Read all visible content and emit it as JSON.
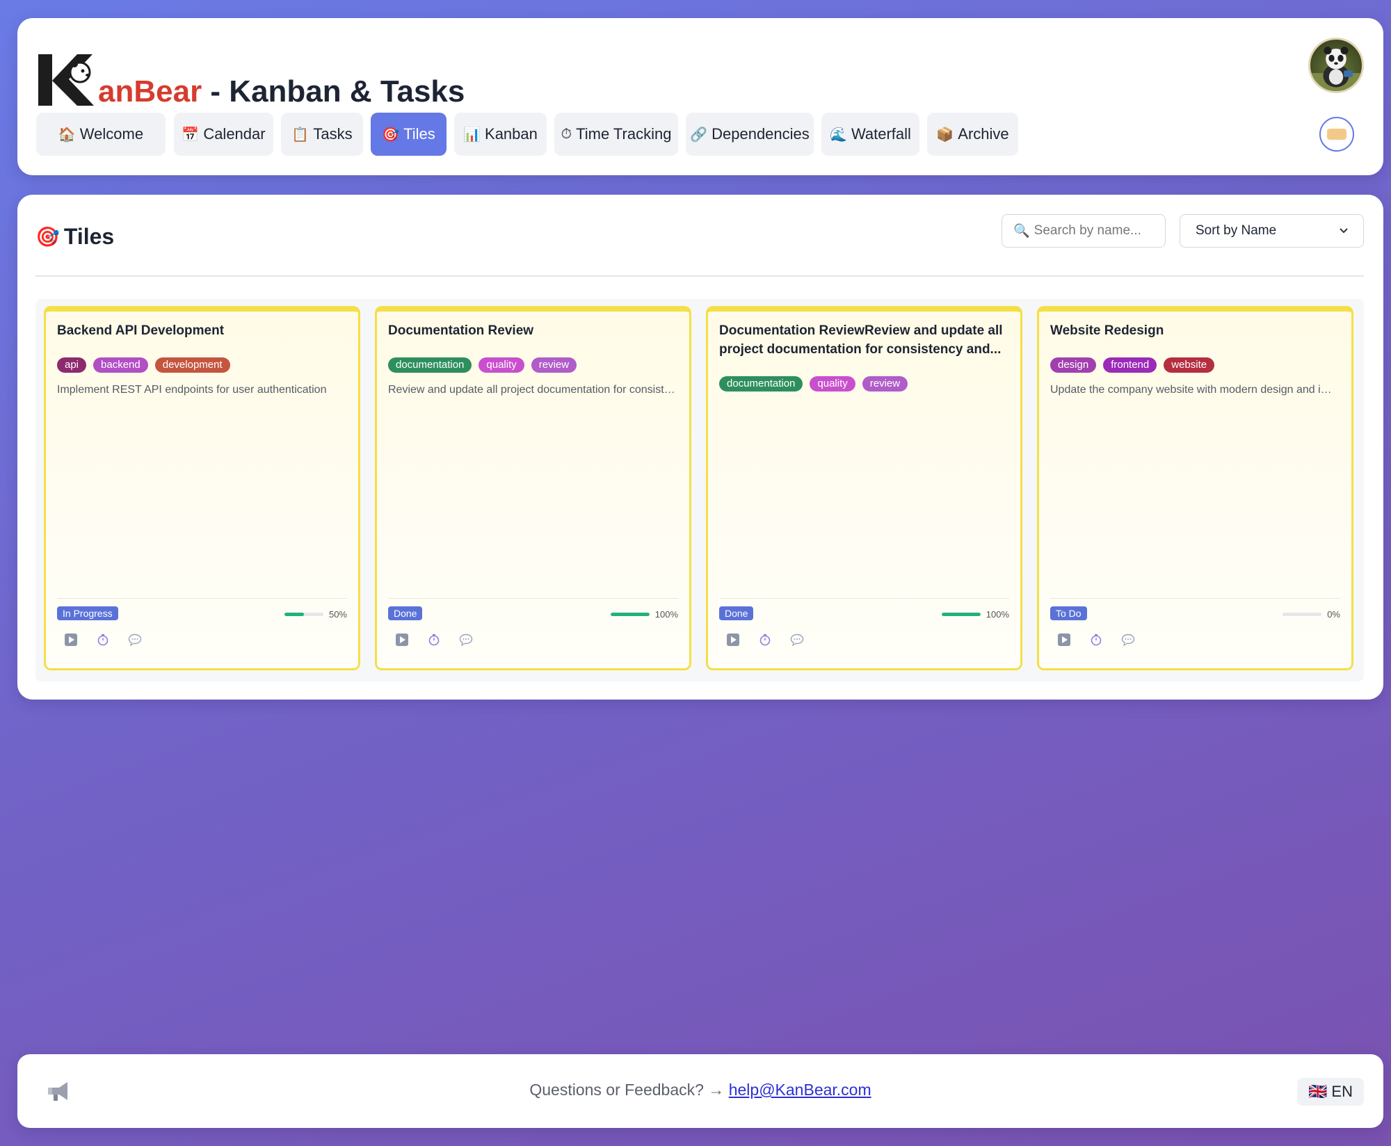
{
  "header": {
    "brand_suffix": "anBear",
    "title_rest": " - Kanban & Tasks",
    "nav": [
      {
        "icon": "🏠",
        "label": "Welcome",
        "active": false
      },
      {
        "icon": "📅",
        "label": "Calendar",
        "active": false
      },
      {
        "icon": "📋",
        "label": "Tasks",
        "active": false
      },
      {
        "icon": "🎯",
        "label": "Tiles",
        "active": true
      },
      {
        "icon": "📊",
        "label": "Kanban",
        "active": false
      },
      {
        "icon": "⏱",
        "label": "Time Tracking",
        "active": false
      },
      {
        "icon": "🔗",
        "label": "Dependencies",
        "active": false
      },
      {
        "icon": "🌊",
        "label": "Waterfall",
        "active": false
      },
      {
        "icon": "📦",
        "label": "Archive",
        "active": false
      }
    ]
  },
  "main": {
    "title_icon": "🎯",
    "title": "Tiles",
    "search_placeholder": "Search by name...",
    "sort_label": "Sort by Name",
    "tiles": [
      {
        "title": "Backend API Development",
        "tags": [
          {
            "label": "api",
            "color": "#8e2a6e"
          },
          {
            "label": "backend",
            "color": "#b14fc4"
          },
          {
            "label": "development",
            "color": "#c4553f"
          }
        ],
        "description": "Implement REST API endpoints for user authentication",
        "status": "In Progress",
        "progress": 50,
        "progress_label": "50%"
      },
      {
        "title": "Documentation Review",
        "tags": [
          {
            "label": "documentation",
            "color": "#2e8f5e"
          },
          {
            "label": "quality",
            "color": "#c94fcf"
          },
          {
            "label": "review",
            "color": "#b05cc9"
          }
        ],
        "description": "Review and update all project documentation for consistency",
        "status": "Done",
        "progress": 100,
        "progress_label": "100%"
      },
      {
        "title": "Documentation ReviewReview and update all project documentation for consistency and...",
        "tags": [
          {
            "label": "documentation",
            "color": "#2e8f5e"
          },
          {
            "label": "quality",
            "color": "#c94fcf"
          },
          {
            "label": "review",
            "color": "#b05cc9"
          }
        ],
        "description": "",
        "status": "Done",
        "progress": 100,
        "progress_label": "100%"
      },
      {
        "title": "Website Redesign",
        "tags": [
          {
            "label": "design",
            "color": "#a23fae"
          },
          {
            "label": "frontend",
            "color": "#9b2ab8"
          },
          {
            "label": "website",
            "color": "#b52e3f"
          }
        ],
        "description": "Update the company website with modern design and improved UX",
        "status": "To Do",
        "progress": 0,
        "progress_label": "0%"
      }
    ]
  },
  "footer": {
    "feedback_text": "Questions or Feedback? → ",
    "email": "help@KanBear.com",
    "lang_flag": "🇬🇧",
    "lang": "EN"
  },
  "icons": {
    "play": "play-icon",
    "timer": "timer-icon",
    "comment": "comment-icon"
  }
}
